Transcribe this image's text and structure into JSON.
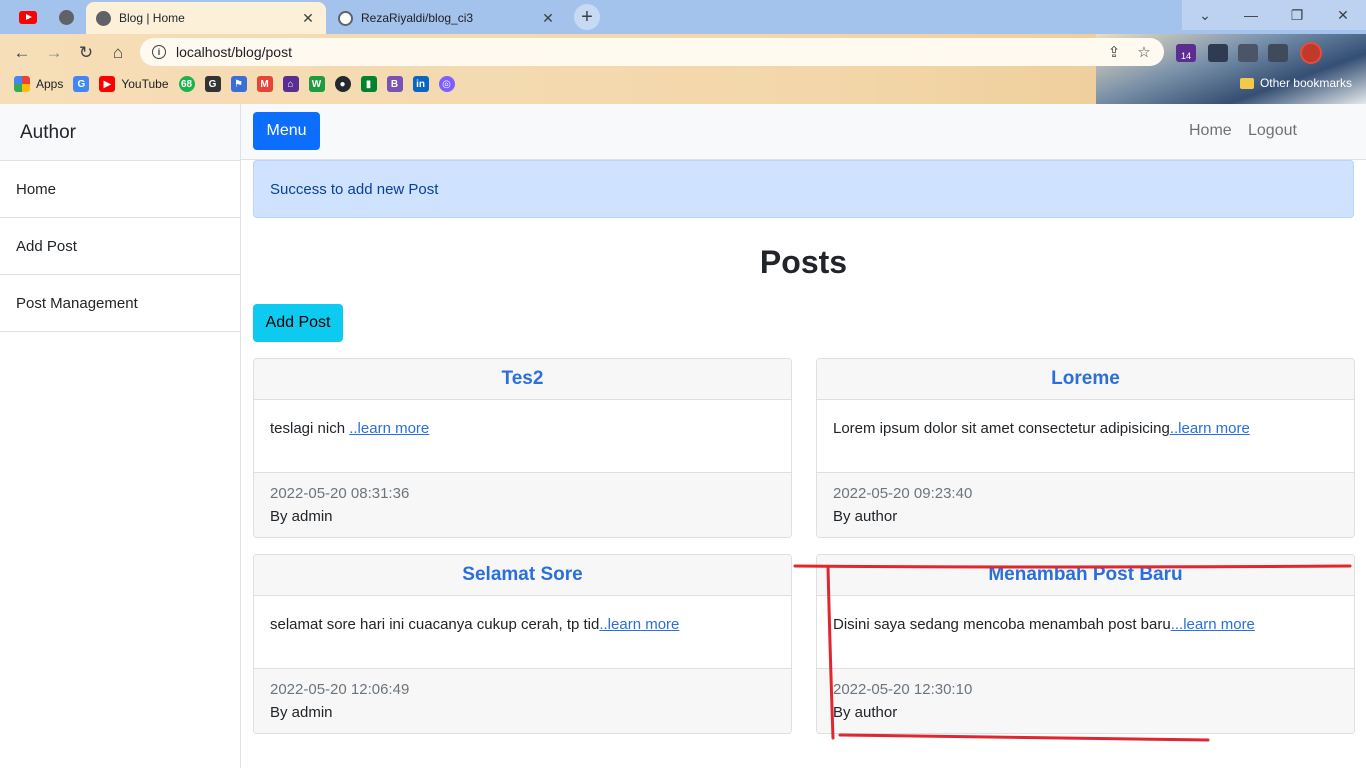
{
  "browser": {
    "tabs": [
      {
        "title": "Blog | Home",
        "icon": "globe-icon",
        "active": true
      },
      {
        "title": "RezaRiyaldi/blog_ci3",
        "icon": "github-icon",
        "active": false
      }
    ],
    "url": "localhost/blog/post",
    "bookmarks": [
      {
        "label": "Apps",
        "icon": "apps-grid-icon"
      },
      {
        "label": "",
        "icon": "translate-icon"
      },
      {
        "label": "YouTube",
        "icon": "youtube-icon"
      }
    ],
    "other_bookmarks": "Other bookmarks",
    "extension_badge": "14"
  },
  "sidebar": {
    "heading": "Author",
    "items": [
      {
        "label": "Home"
      },
      {
        "label": "Add Post"
      },
      {
        "label": "Post Management"
      }
    ]
  },
  "topnav": {
    "menu_label": "Menu",
    "links": [
      {
        "label": "Home"
      },
      {
        "label": "Logout"
      }
    ]
  },
  "alert": {
    "message": "Success to add new Post"
  },
  "page": {
    "title": "Posts",
    "add_post_label": "Add Post"
  },
  "posts": [
    {
      "title": "Tes2",
      "excerpt": "teslagi nich ",
      "more": "..learn more",
      "date": "2022-05-20 08:31:36",
      "author": "By admin"
    },
    {
      "title": "Loreme",
      "excerpt": "Lorem ipsum dolor sit amet consectetur adipisicing",
      "more": "..learn more",
      "date": "2022-05-20 09:23:40",
      "author": "By author"
    },
    {
      "title": "Selamat Sore",
      "excerpt": "selamat sore hari ini cuacanya cukup cerah, tp tid",
      "more": "..learn more",
      "date": "2022-05-20 12:06:49",
      "author": "By admin"
    },
    {
      "title": "Menambah Post Baru",
      "excerpt": "Disini saya sedang mencoba menambah post baru",
      "more": "...learn more",
      "date": "2022-05-20 12:30:10",
      "author": "By author"
    }
  ],
  "colors": {
    "primary": "#0d6efd",
    "info": "#0dcaf0",
    "alert_bg": "#cfe2ff",
    "link": "#2a6fdb",
    "annotation": "#e0262e"
  }
}
